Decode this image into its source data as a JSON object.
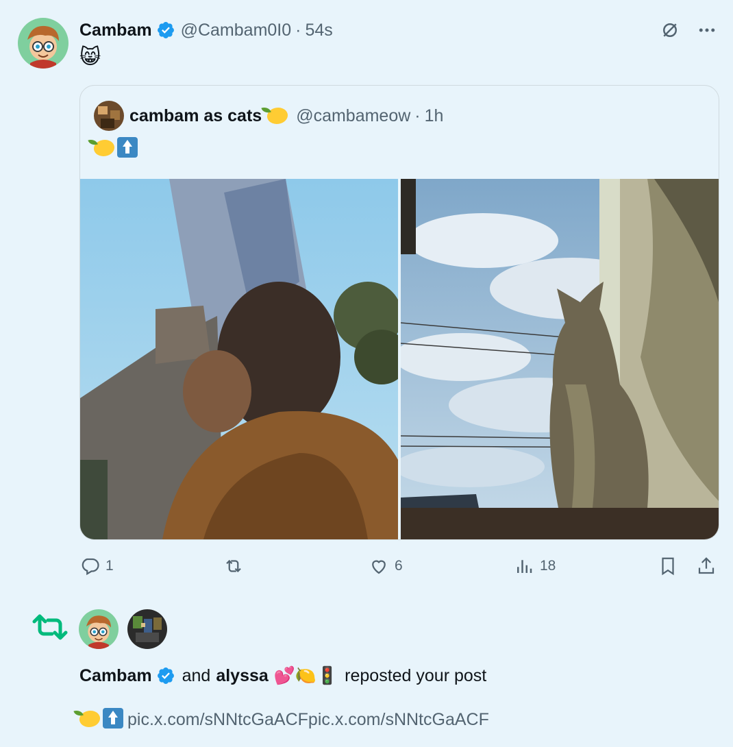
{
  "post": {
    "author_name": "Cambam",
    "author_handle": "@Cambam0I0",
    "separator": "·",
    "time": "54s",
    "text": "😸"
  },
  "quote": {
    "author_name": "cambam as cats",
    "author_handle": "@cambameow",
    "separator": "·",
    "time": "1h",
    "images": [
      "photo-of-boy-looking-up",
      "photo-of-cat-looking-up"
    ]
  },
  "actions": {
    "reply_count": "1",
    "repost_count": "",
    "like_count": "6",
    "views_count": "18"
  },
  "notification": {
    "user1_name": "Cambam",
    "connector": "and",
    "user2_name": "alyssa",
    "user2_emojis": "💕🍋🚦",
    "action_text": "reposted your post",
    "preview_link": "pic.x.com/sNNtcGaACFpic.x.com/sNNtcGaACF"
  },
  "colors": {
    "background": "#e8f4fb",
    "verified": "#1d9bf0",
    "repost_green": "#00ba7c",
    "muted": "#536471"
  },
  "icons": [
    "verified-badge-icon",
    "grok-icon",
    "more-icon",
    "reply-icon",
    "repost-icon",
    "like-icon",
    "views-icon",
    "bookmark-icon",
    "share-icon"
  ]
}
